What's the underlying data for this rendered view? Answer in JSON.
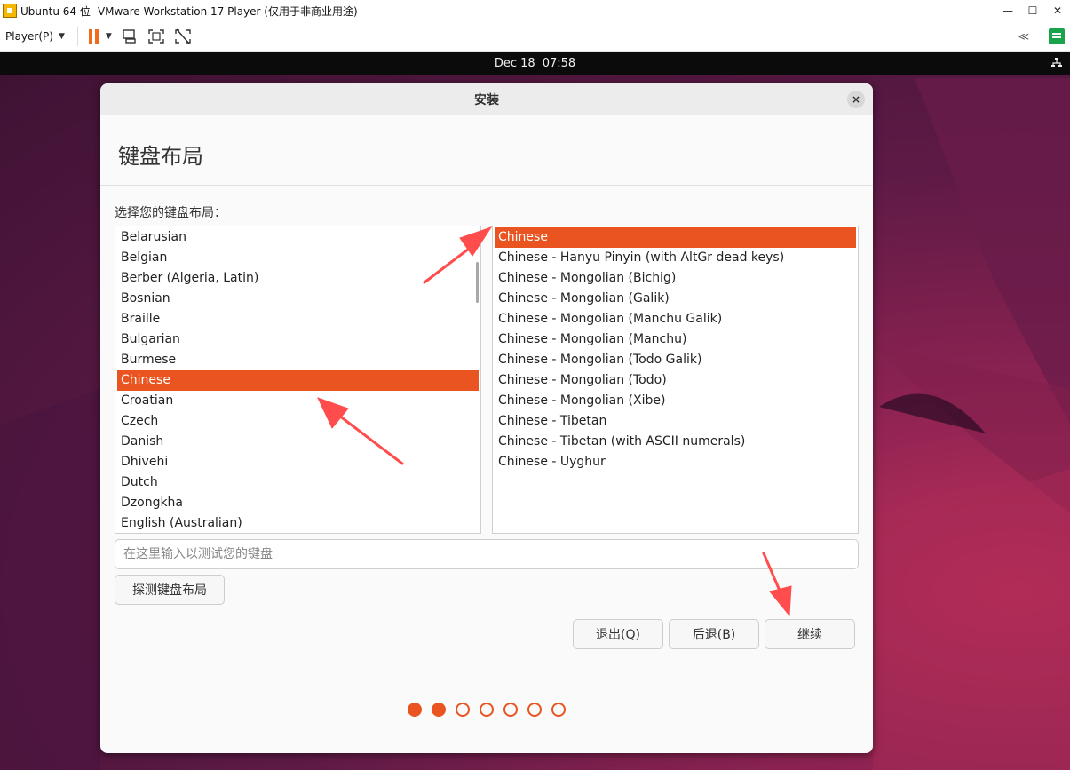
{
  "titlebar": {
    "title": "Ubuntu 64 位- VMware Workstation 17 Player (仅用于非商业用途)",
    "minimize": "—",
    "maximize": "☐",
    "close": "✕"
  },
  "toolbar": {
    "player_menu": "Player(P)",
    "collapse": "≪"
  },
  "gnome": {
    "date": "Dec 18",
    "time": "07:58"
  },
  "installer": {
    "window_title": "安装",
    "close_glyph": "×",
    "page_title": "键盘布局",
    "prompt": "选择您的键盘布局：",
    "layouts": [
      "Belarusian",
      "Belgian",
      "Berber (Algeria, Latin)",
      "Bosnian",
      "Braille",
      "Bulgarian",
      "Burmese",
      "Chinese",
      "Croatian",
      "Czech",
      "Danish",
      "Dhivehi",
      "Dutch",
      "Dzongkha",
      "English (Australian)"
    ],
    "selected_layout": "Chinese",
    "variants": [
      "Chinese",
      "Chinese - Hanyu Pinyin (with AltGr dead keys)",
      "Chinese - Mongolian (Bichig)",
      "Chinese - Mongolian (Galik)",
      "Chinese - Mongolian (Manchu Galik)",
      "Chinese - Mongolian (Manchu)",
      "Chinese - Mongolian (Todo Galik)",
      "Chinese - Mongolian (Todo)",
      "Chinese - Mongolian (Xibe)",
      "Chinese - Tibetan",
      "Chinese - Tibetan (with ASCII numerals)",
      "Chinese - Uyghur"
    ],
    "selected_variant": "Chinese",
    "test_placeholder": "在这里输入以测试您的键盘",
    "test_value": "",
    "detect_button": "探测键盘布局",
    "quit_button": "退出(Q)",
    "back_button": "后退(B)",
    "continue_button": "继续",
    "steps_total": 7,
    "steps_completed": 2
  },
  "colors": {
    "accent": "#e95420",
    "annotation": "#ff4d4d"
  }
}
